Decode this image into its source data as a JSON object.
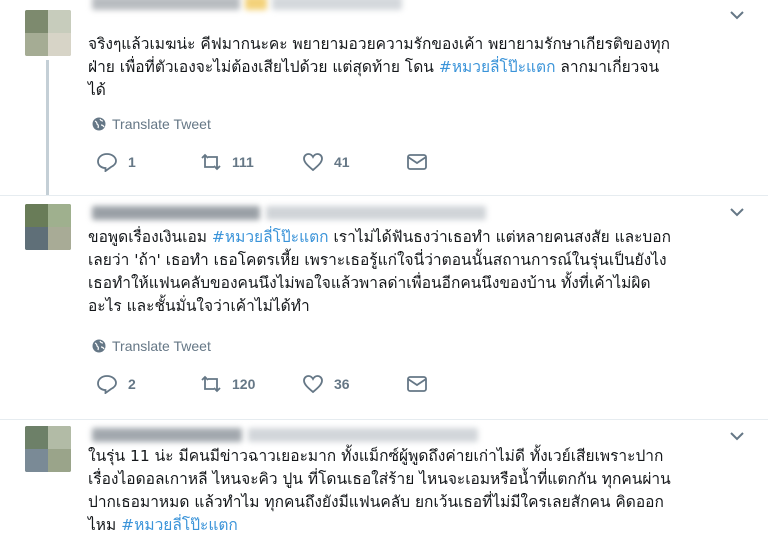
{
  "tweets": [
    {
      "text_parts": [
        "จริงๆแล้วเมฆน่ะ คีฟมากนะคะ พยายามอวยความรักของเค้า พยายามรักษาเกียรติของทุก",
        "ฝ่าย เพื่อที่ตัวเองจะไม่ต้องเสียไปด้วย แต่สุดท้าย โดน ",
        "#หมวยลี่โป๊ะแตก",
        " ลากมาเกี่ยวจน",
        "ได้"
      ],
      "translate": "Translate Tweet",
      "replies": "1",
      "retweets": "111",
      "likes": "41"
    },
    {
      "text_parts": [
        "ขอพูดเรื่องเงินเอม ",
        "#หมวยลี่โป๊ะแตก",
        " เราไม่ได้ฟันธงว่าเธอทำ แต่หลายคนสงสัย และบอก",
        "เลยว่า 'ถ้า' เธอทำ เธอโคตรเหี้ย เพราะเธอรู้แก่ใจนี่ว่าตอนนั้นสถานการณ์ในรุ่นเป็นยังไง",
        "เธอทำให้แฟนคลับของคนนึงไม่พอใจแล้วพาลด่าเพื่อนอีกคนนึงของบ้าน ทั้งที่เค้าไม่ผิด",
        "อะไร และชั้นมั่นใจว่าเค้าไม่ได้ทำ"
      ],
      "translate": "Translate Tweet",
      "replies": "2",
      "retweets": "120",
      "likes": "36"
    },
    {
      "text_parts": [
        "ในรุ่น 11 น่ะ มีคนมีข่าวฉาวเยอะมาก ทั้งแม็กซ์ผู้พูดถึงค่ายเก่าไม่ดี ทั้งเวย์เสียเพราะปาก",
        "เรื่องไอดอลเกาหลี ไหนจะคิว ปูน ที่โดนเธอใส่ร้าย ไหนจะเอมหรือน้ำที่แตกกัน ทุกคนผ่าน",
        "ปากเธอมาหมด แล้วทำไม ทุกคนถึงยังมีแฟนคลับ ยกเว้นเธอที่ไม่มีใครเลยสักคน คิดออก",
        "ไหม ",
        "#หมวยลี่โป๊ะแตก"
      ]
    }
  ],
  "colors": {
    "hashtag": "#3b94d9",
    "meta": "#657786",
    "text": "#14171a",
    "divider": "#e6ecf0"
  },
  "icons": [
    "globe-icon",
    "reply-icon",
    "retweet-icon",
    "heart-icon",
    "message-icon",
    "chevron-down-icon"
  ]
}
